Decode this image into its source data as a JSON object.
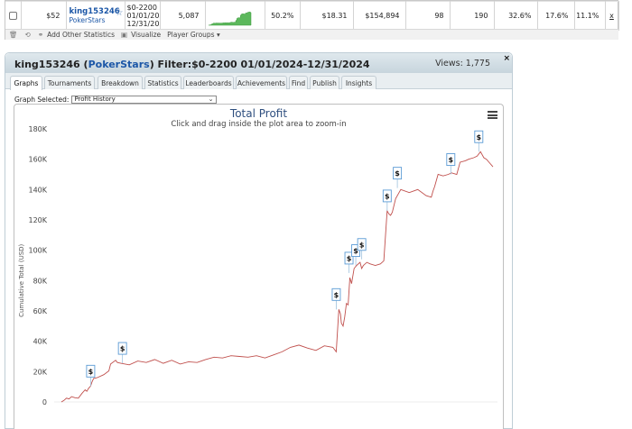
{
  "stats_row": {
    "stake": "$52",
    "player_name": "king153246",
    "player_site": "PokerStars",
    "filter_lines": [
      "$0-2200",
      "01/01/202",
      "12/31/202"
    ],
    "games": "5,087",
    "vpip": "50.2%",
    "avg_stake": "$18.31",
    "profit": "$154,894",
    "col_a": "98",
    "col_b": "190",
    "col_c": "32.6%",
    "col_d": "17.6%",
    "col_e": "11.1%",
    "remove": "x"
  },
  "toolbar": {
    "add_stats": "Add Other Statistics",
    "visualize": "Visualize",
    "player_groups": "Player Groups ▾"
  },
  "panel": {
    "player": "king153246",
    "site": "PokerStars",
    "filter": "Filter:$0-2200 01/01/2024-12/31/2024",
    "views": "Views: 1,775",
    "close": "×",
    "tabs": [
      "Graphs",
      "Tournaments",
      "Breakdown",
      "Statistics",
      "Leaderboards",
      "Achievements",
      "Find",
      "Publish",
      "Insights"
    ],
    "active_tab": "Graphs",
    "graph_selected_label": "Graph Selected:",
    "graph_selected_value": "Profit History"
  },
  "chart_data": {
    "type": "line",
    "title": "Total Profit",
    "subtitle": "Click and drag inside the plot area to zoom-in",
    "ylabel": "Cumulative Total (USD)",
    "xlabel": "",
    "ylim": [
      -20000,
      180000
    ],
    "yticks": [
      0,
      20000,
      40000,
      60000,
      80000,
      100000,
      120000,
      140000,
      160000,
      180000
    ],
    "ytick_labels": [
      "0",
      "20K",
      "40K",
      "60K",
      "80K",
      "100K",
      "120K",
      "140K",
      "160K",
      "180K"
    ],
    "x_range": [
      0,
      5087
    ],
    "grid": false,
    "series": [
      {
        "color": "#c0504d",
        "x": [
          0,
          30,
          60,
          90,
          120,
          160,
          200,
          240,
          280,
          300,
          320,
          345,
          360,
          380,
          420,
          500,
          560,
          580,
          640,
          660,
          700,
          800,
          900,
          1000,
          1100,
          1200,
          1300,
          1400,
          1500,
          1600,
          1700,
          1800,
          1900,
          2000,
          2100,
          2200,
          2300,
          2400,
          2500,
          2600,
          2700,
          2800,
          2900,
          3000,
          3100,
          3200,
          3240,
          3270,
          3290,
          3300,
          3320,
          3340,
          3360,
          3380,
          3400,
          3420,
          3450,
          3480,
          3520,
          3540,
          3560,
          3600,
          3640,
          3700,
          3760,
          3800,
          3840,
          3860,
          3880,
          3900,
          3940,
          4000,
          4100,
          4200,
          4300,
          4360,
          4380,
          4400,
          4440,
          4500,
          4560,
          4600,
          4660,
          4700,
          4760,
          4800,
          4860,
          4900,
          4940,
          4980,
          5010,
          5040,
          5087
        ],
        "y": [
          0,
          1000,
          2500,
          2000,
          3500,
          2800,
          2500,
          5500,
          8000,
          7000,
          9000,
          10500,
          13000,
          15500,
          16000,
          18000,
          20500,
          25000,
          27500,
          26000,
          25500,
          24500,
          27000,
          26000,
          28000,
          25500,
          27500,
          25000,
          26500,
          26000,
          28000,
          29500,
          29000,
          30500,
          30000,
          29500,
          30500,
          29000,
          31000,
          33000,
          36000,
          37500,
          35500,
          34000,
          37000,
          36000,
          33000,
          61000,
          58000,
          52000,
          50000,
          56000,
          65000,
          64000,
          82000,
          78000,
          88000,
          90000,
          92000,
          88000,
          90000,
          92000,
          91000,
          90000,
          91000,
          93000,
          126000,
          124000,
          123000,
          125000,
          134000,
          140000,
          138000,
          140000,
          136000,
          135000,
          139000,
          142000,
          150000,
          149000,
          150000,
          151000,
          150000,
          158000,
          159000,
          160000,
          161000,
          162000,
          165000,
          161000,
          160000,
          158000,
          155000
        ]
      }
    ],
    "markers": [
      {
        "x": 345,
        "y": 10500,
        "label": "$"
      },
      {
        "x": 720,
        "y": 25500,
        "label": "$"
      },
      {
        "x": 3240,
        "y": 61000,
        "label": "$"
      },
      {
        "x": 3390,
        "y": 85000,
        "label": "$"
      },
      {
        "x": 3470,
        "y": 90000,
        "label": "$"
      },
      {
        "x": 3540,
        "y": 94000,
        "label": "$"
      },
      {
        "x": 3840,
        "y": 126000,
        "label": "$"
      },
      {
        "x": 3960,
        "y": 141000,
        "label": "$"
      },
      {
        "x": 4590,
        "y": 150000,
        "label": "$"
      },
      {
        "x": 4920,
        "y": 165000,
        "label": "$"
      }
    ]
  }
}
